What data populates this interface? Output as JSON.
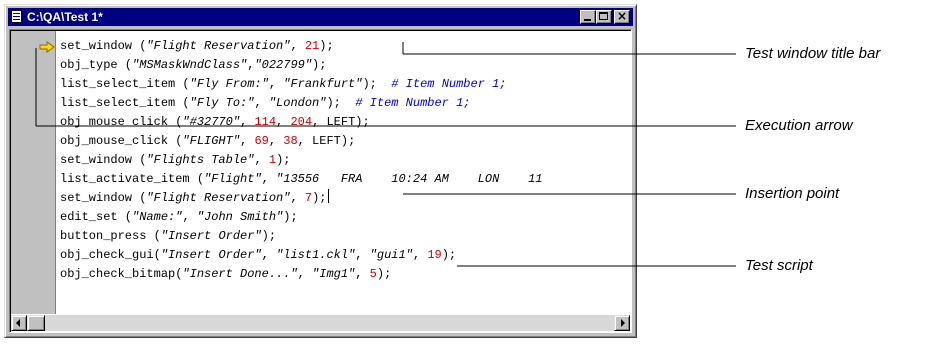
{
  "window": {
    "title": "C:\\QA\\Test 1*",
    "icon": "script-document-icon",
    "controls": {
      "minimize": "minimize-icon",
      "maximize": "maximize-icon",
      "close": "close-icon",
      "close_glyph": "×"
    }
  },
  "script_lines": [
    {
      "tokens": [
        {
          "t": "set_window (",
          "c": "p"
        },
        {
          "t": "\"Flight Reservation\"",
          "c": "str"
        },
        {
          "t": ", ",
          "c": "p"
        },
        {
          "t": "21",
          "c": "num"
        },
        {
          "t": ");",
          "c": "p"
        }
      ]
    },
    {
      "tokens": [
        {
          "t": "obj_type (",
          "c": "p"
        },
        {
          "t": "\"MSMaskWndClass\"",
          "c": "str"
        },
        {
          "t": ",",
          "c": "p"
        },
        {
          "t": "\"022799\"",
          "c": "str"
        },
        {
          "t": ");",
          "c": "p"
        }
      ]
    },
    {
      "tokens": [
        {
          "t": "list_select_item (",
          "c": "p"
        },
        {
          "t": "\"Fly From:\"",
          "c": "str"
        },
        {
          "t": ", ",
          "c": "p"
        },
        {
          "t": "\"Frankfurt\"",
          "c": "str"
        },
        {
          "t": ");  ",
          "c": "p"
        },
        {
          "t": "# Item Number 1;",
          "c": "cmt"
        }
      ]
    },
    {
      "tokens": [
        {
          "t": "list_select_item (",
          "c": "p"
        },
        {
          "t": "\"Fly To:\"",
          "c": "str"
        },
        {
          "t": ", ",
          "c": "p"
        },
        {
          "t": "\"London\"",
          "c": "str"
        },
        {
          "t": ");  ",
          "c": "p"
        },
        {
          "t": "# Item Number 1;",
          "c": "cmt"
        }
      ]
    },
    {
      "tokens": [
        {
          "t": "obj_mouse_click (",
          "c": "p"
        },
        {
          "t": "\"#32770\"",
          "c": "str"
        },
        {
          "t": ", ",
          "c": "p"
        },
        {
          "t": "114",
          "c": "num"
        },
        {
          "t": ", ",
          "c": "p"
        },
        {
          "t": "204",
          "c": "num"
        },
        {
          "t": ", LEFT);",
          "c": "p"
        }
      ]
    },
    {
      "tokens": [
        {
          "t": "obj_mouse_click (",
          "c": "p"
        },
        {
          "t": "\"FLIGHT\"",
          "c": "str"
        },
        {
          "t": ", ",
          "c": "p"
        },
        {
          "t": "69",
          "c": "num"
        },
        {
          "t": ", ",
          "c": "p"
        },
        {
          "t": "38",
          "c": "num"
        },
        {
          "t": ", LEFT);",
          "c": "p"
        }
      ]
    },
    {
      "tokens": [
        {
          "t": "set_window (",
          "c": "p"
        },
        {
          "t": "\"Flights Table\"",
          "c": "str"
        },
        {
          "t": ", ",
          "c": "p"
        },
        {
          "t": "1",
          "c": "num"
        },
        {
          "t": ");",
          "c": "p"
        }
      ]
    },
    {
      "tokens": [
        {
          "t": "list_activate_item (",
          "c": "p"
        },
        {
          "t": "\"Flight\"",
          "c": "str"
        },
        {
          "t": ", ",
          "c": "p"
        },
        {
          "t": "\"13556   FRA    10:24 AM    LON    11",
          "c": "str"
        }
      ]
    },
    {
      "tokens": [
        {
          "t": "set_window (",
          "c": "p"
        },
        {
          "t": "\"Flight Reservation\"",
          "c": "str"
        },
        {
          "t": ", ",
          "c": "p"
        },
        {
          "t": "7",
          "c": "num"
        },
        {
          "t": ");",
          "c": "p"
        }
      ],
      "caret": true
    },
    {
      "tokens": [
        {
          "t": "edit_set (",
          "c": "p"
        },
        {
          "t": "\"Name:\"",
          "c": "str"
        },
        {
          "t": ", ",
          "c": "p"
        },
        {
          "t": "\"John Smith\"",
          "c": "str"
        },
        {
          "t": ");",
          "c": "p"
        }
      ]
    },
    {
      "tokens": [
        {
          "t": "button_press (",
          "c": "p"
        },
        {
          "t": "\"Insert Order\"",
          "c": "str"
        },
        {
          "t": ");",
          "c": "p"
        }
      ]
    },
    {
      "tokens": [
        {
          "t": "obj_check_gui(",
          "c": "p"
        },
        {
          "t": "\"Insert Order\"",
          "c": "str"
        },
        {
          "t": ", ",
          "c": "p"
        },
        {
          "t": "\"list1.ckl\"",
          "c": "str"
        },
        {
          "t": ", ",
          "c": "p"
        },
        {
          "t": "\"gui1\"",
          "c": "str"
        },
        {
          "t": ", ",
          "c": "p"
        },
        {
          "t": "19",
          "c": "num"
        },
        {
          "t": ");",
          "c": "p"
        }
      ]
    },
    {
      "tokens": [
        {
          "t": "obj_check_bitmap(",
          "c": "p"
        },
        {
          "t": "\"Insert Done...\"",
          "c": "str"
        },
        {
          "t": ", ",
          "c": "p"
        },
        {
          "t": "\"Img1\"",
          "c": "str"
        },
        {
          "t": ", ",
          "c": "p"
        },
        {
          "t": "5",
          "c": "num"
        },
        {
          "t": ");",
          "c": "p"
        }
      ]
    }
  ],
  "execution_arrow": {
    "icon": "execution-arrow-icon",
    "color": "#ffd800"
  },
  "scrollbar": {
    "left_icon": "scroll-left-icon",
    "right_icon": "scroll-right-icon"
  },
  "callouts": {
    "title_bar": "Test window title bar",
    "execution_arrow": "Execution arrow",
    "insertion_point": "Insertion point",
    "test_script": "Test script"
  }
}
